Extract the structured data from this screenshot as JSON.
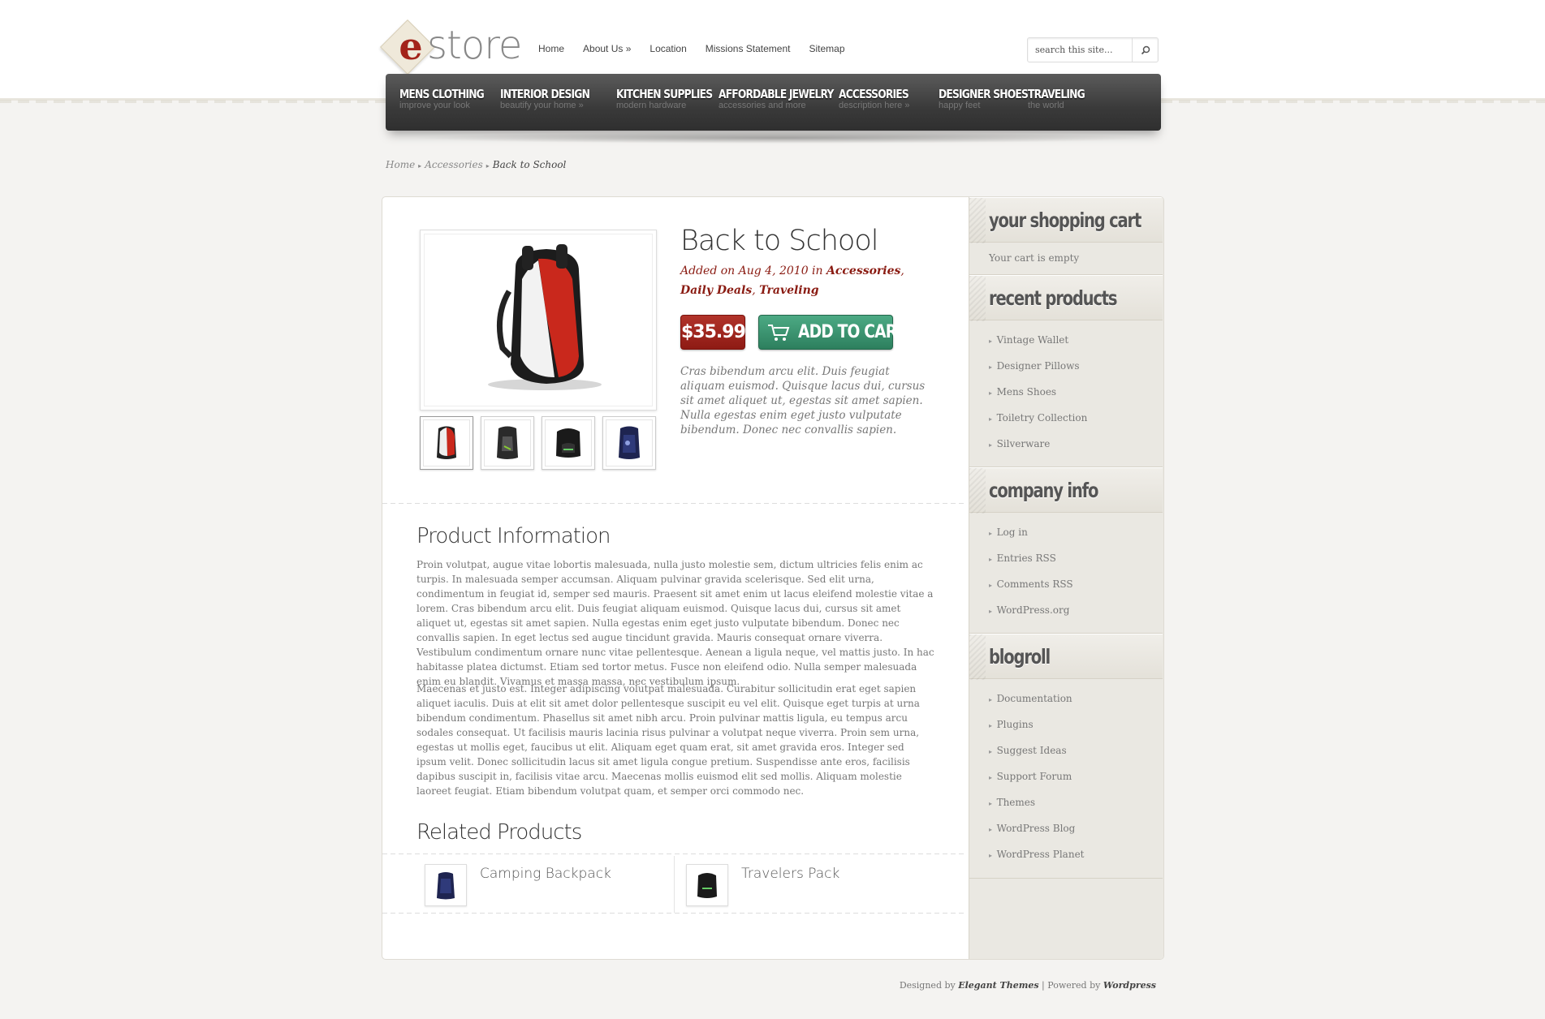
{
  "logo": {
    "mark": "e",
    "word": "store"
  },
  "topnav": [
    "Home",
    "About Us »",
    "Location",
    "Missions Statement",
    "Sitemap"
  ],
  "search": {
    "placeholder": "search this site..."
  },
  "categories": [
    {
      "title": "MENS CLOTHING",
      "sub": "improve your look"
    },
    {
      "title": "INTERIOR DESIGN",
      "sub": "beautify your home »"
    },
    {
      "title": "KITCHEN SUPPLIES",
      "sub": "modern hardware"
    },
    {
      "title": "AFFORDABLE JEWELRY",
      "sub": "accessories and more"
    },
    {
      "title": "ACCESSORIES",
      "sub": "description here »"
    },
    {
      "title": "DESIGNER SHOES",
      "sub": "happy feet"
    },
    {
      "title": "TRAVELING",
      "sub": "the world"
    }
  ],
  "breadcrumb": {
    "home": "Home",
    "parent": "Accessories",
    "current": "Back to School"
  },
  "product": {
    "title": "Back to School",
    "meta_prefix": "Added on Aug 4, 2010 in",
    "cat1": "Accessories",
    "cat2": "Daily Deals",
    "cat3": "Traveling",
    "price": "$35.99",
    "add_to_cart": "ADD TO CART",
    "description": "Cras bibendum arcu elit. Duis feugiat aliquam euismod. Quisque lacus dui, cursus sit amet aliquet ut, egestas sit amet sapien. Nulla egestas enim eget justo vulputate bibendum. Donec nec convallis sapien."
  },
  "info": {
    "heading": "Product Information",
    "p1": "Proin volutpat, augue vitae lobortis malesuada, nulla justo molestie sem, dictum ultricies felis enim ac turpis. In malesuada semper accumsan. Aliquam pulvinar gravida scelerisque. Sed elit urna, condimentum in feugiat id, semper sed mauris. Praesent sit amet enim ut lacus eleifend molestie vitae a lorem. Cras bibendum arcu elit. Duis feugiat aliquam euismod. Quisque lacus dui, cursus sit amet aliquet ut, egestas sit amet sapien. Nulla egestas enim eget justo vulputate bibendum. Donec nec convallis sapien. In eget lectus sed augue tincidunt gravida. Mauris consequat ornare viverra. Vestibulum condimentum ornare nunc vitae pellentesque. Aenean a ligula neque, vel mattis justo. In hac habitasse platea dictumst. Etiam sed tortor metus. Fusce non eleifend odio. Nulla semper malesuada enim eu blandit. Vivamus et massa massa, nec vestibulum ipsum.",
    "p2": "Maecenas et justo est. Integer adipiscing volutpat malesuada. Curabitur sollicitudin erat eget sapien aliquet iaculis. Duis at elit sit amet dolor pellentesque suscipit eu vel elit. Quisque eget turpis at urna bibendum condimentum. Phasellus sit amet nibh arcu. Proin pulvinar mattis ligula, eu tempus arcu sodales consequat. Ut facilisis mauris lacinia risus pulvinar a volutpat neque viverra. Proin sem urna, egestas ut mollis eget, faucibus ut elit. Aliquam eget quam erat, sit amet gravida eros. Integer sed ipsum velit. Donec sollicitudin lacus sit amet ligula congue pretium. Suspendisse ante eros, facilisis dapibus suscipit in, facilisis vitae arcu. Maecenas mollis euismod elit sed mollis. Aliquam molestie laoreet feugiat. Etiam bibendum volutpat quam, et semper orci commodo nec."
  },
  "related": {
    "heading": "Related Products",
    "items": [
      {
        "name": "Camping Backpack"
      },
      {
        "name": "Travelers Pack"
      }
    ]
  },
  "sidebar": {
    "cart": {
      "heading": "your shopping cart",
      "empty": "Your cart is empty"
    },
    "recent": {
      "heading": "recent products",
      "items": [
        "Vintage Wallet",
        "Designer Pillows",
        "Mens Shoes",
        "Toiletry Collection",
        "Silverware"
      ]
    },
    "company": {
      "heading": "company info",
      "items": [
        "Log in",
        "Entries RSS",
        "Comments RSS",
        "WordPress.org"
      ]
    },
    "blogroll": {
      "heading": "blogroll",
      "items": [
        "Documentation",
        "Plugins",
        "Suggest Ideas",
        "Support Forum",
        "Themes",
        "WordPress Blog",
        "WordPress Planet"
      ]
    }
  },
  "footer": {
    "designed_by": "Designed by",
    "designer": "Elegant Themes",
    "sep": "|",
    "powered_by": "Powered by",
    "platform": "Wordpress"
  },
  "colors": {
    "accent_red": "#8a1b12",
    "cart_green": "#3b9470",
    "nav_dark": "#3a3a3a"
  }
}
